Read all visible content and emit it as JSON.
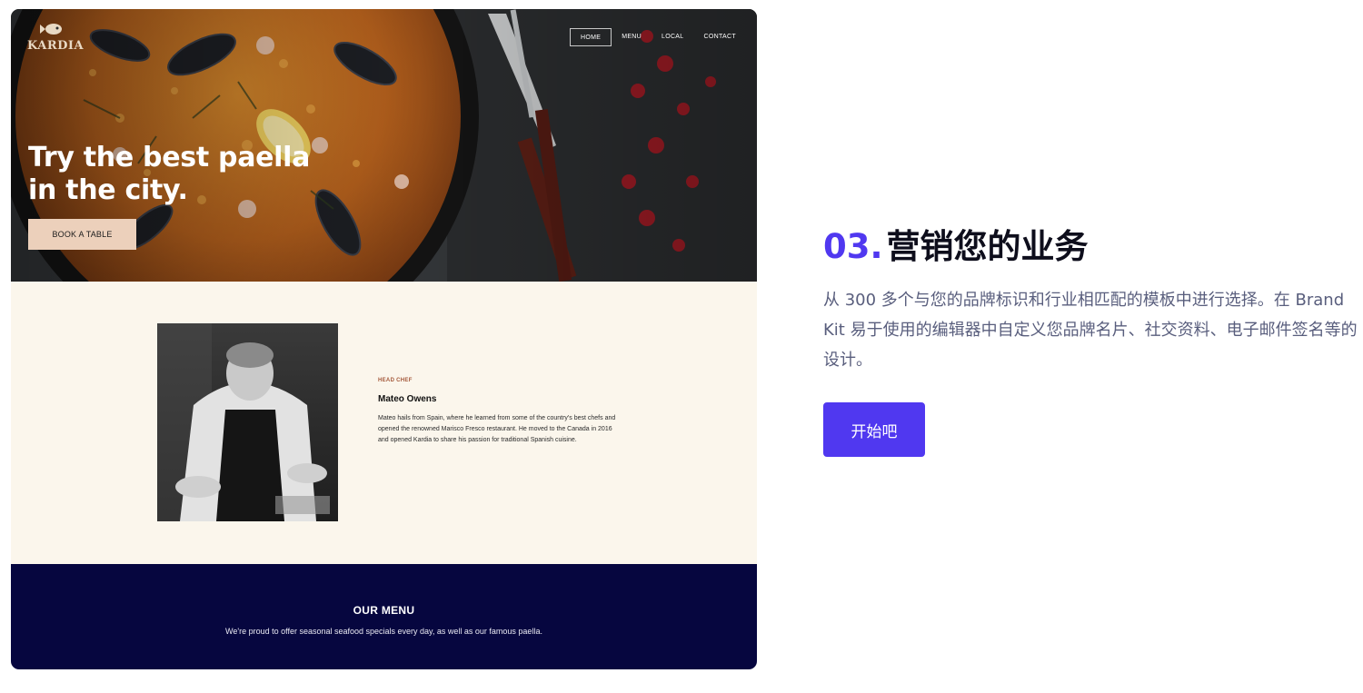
{
  "preview": {
    "logo": {
      "text": "KARDIA",
      "icon": "fish-icon"
    },
    "nav": [
      {
        "label": "HOME",
        "active": true
      },
      {
        "label": "MENU",
        "active": false
      },
      {
        "label": "LOCAL",
        "active": false
      },
      {
        "label": "CONTACT",
        "active": false
      }
    ],
    "hero": {
      "title_line1": "Try the best paella",
      "title_line2": "in the city.",
      "cta_label": "BOOK A TABLE"
    },
    "chef": {
      "role": "HEAD CHEF",
      "name": "Mateo Owens",
      "bio": "Mateo hails from Spain, where he learned from some of the country's best chefs and opened the renowned Marisco Fresco restaurant. He moved to the Canada in 2016 and opened Kardia to share his passion for traditional Spanish cuisine."
    },
    "menu": {
      "title": "OUR MENU",
      "subtitle": "We're proud to offer seasonal seafood specials every day, as well as our famous paella."
    }
  },
  "feature": {
    "number": "03.",
    "title": "营销您的业务",
    "description": "从 300 多个与您的品牌标识和行业相匹配的模板中进行选择。在 Brand Kit 易于使用的编辑器中自定义您品牌名片、社交资料、电子邮件签名等的设计。",
    "button_label": "开始吧"
  },
  "colors": {
    "accent": "#5038f0",
    "heading": "#0e0e1c",
    "body_text": "#595e7d",
    "menu_band": "#06063f",
    "cream": "#fbf6ec",
    "book_button": "#ecd0bb"
  }
}
